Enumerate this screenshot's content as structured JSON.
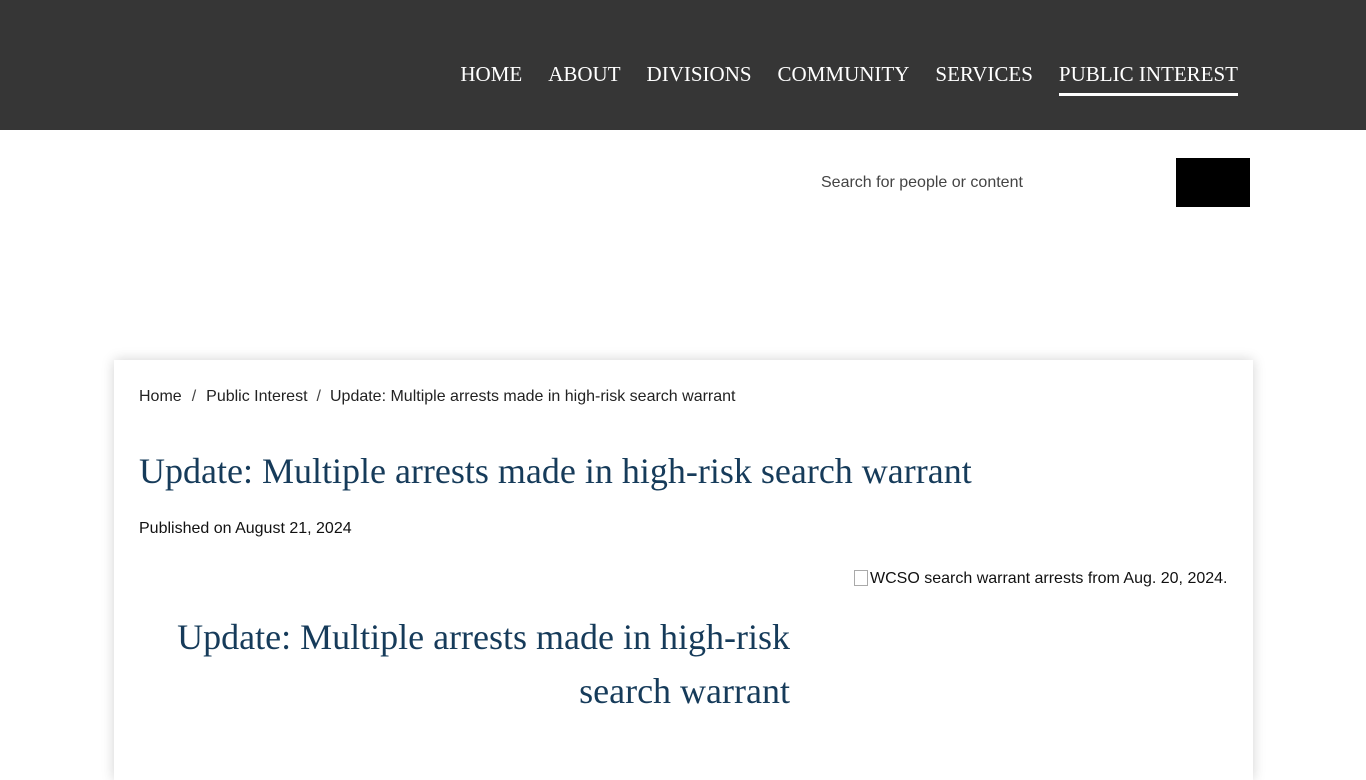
{
  "nav": {
    "items": [
      {
        "label": "HOME"
      },
      {
        "label": "ABOUT"
      },
      {
        "label": "DIVISIONS"
      },
      {
        "label": "COMMUNITY"
      },
      {
        "label": "SERVICES"
      },
      {
        "label": "PUBLIC INTEREST",
        "active": true
      }
    ]
  },
  "search": {
    "placeholder": "Search for people or content"
  },
  "breadcrumb": {
    "home": "Home",
    "separator": "/",
    "section": "Public Interest",
    "current": "Update: Multiple arrests made in high-risk search warrant"
  },
  "article": {
    "title": "Update: Multiple arrests made in high-risk search warrant",
    "published_prefix": "Published on",
    "published_date": "August 21, 2024",
    "image_alt": "WCSO search warrant arrests from Aug. 20, 2024.",
    "subtitle": "Update: Multiple arrests made in high-risk search warrant"
  },
  "colors": {
    "topbar": "#363636",
    "title": "#163b5a",
    "search_button": "#000000"
  }
}
